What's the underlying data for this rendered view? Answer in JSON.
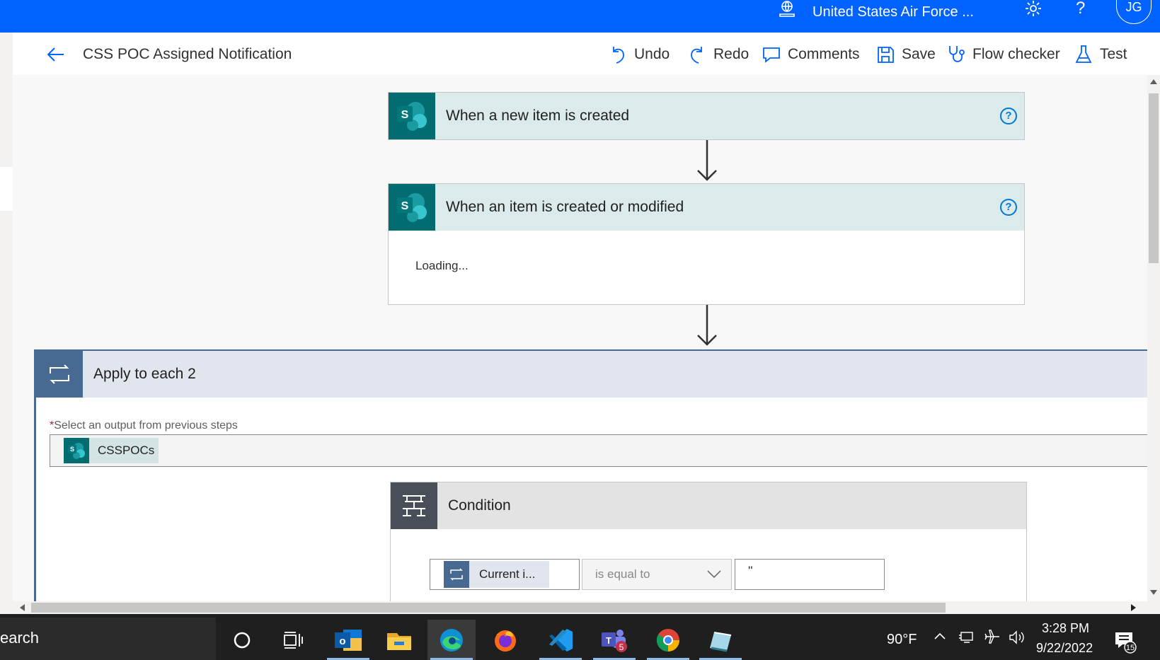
{
  "header": {
    "environment": "United States Air Force ...",
    "avatar_initials": "JG",
    "help_label": "?"
  },
  "commandbar": {
    "flow_title": "CSS POC Assigned Notification",
    "undo": "Undo",
    "redo": "Redo",
    "comments": "Comments",
    "save": "Save",
    "flow_checker": "Flow checker",
    "test": "Test"
  },
  "canvas": {
    "trigger": {
      "title": "When a new item is created",
      "icon_letter": "S"
    },
    "step2": {
      "title": "When an item is created or modified",
      "icon_letter": "S",
      "status": "Loading..."
    },
    "apply_each": {
      "title": "Apply to each 2",
      "required_mark": "*",
      "field_label": "Select an output from previous steps",
      "token": "CSSPOCs",
      "token_icon_letter": "S"
    },
    "condition": {
      "title": "Condition",
      "left_token": "Current i...",
      "operator": "is equal to",
      "right_value": "''"
    }
  },
  "taskbar": {
    "search_text": "earch",
    "teams_badge": "5",
    "temperature": "90°F",
    "time": "3:28 PM",
    "date": "9/22/2022",
    "notification_count": "15"
  },
  "colors": {
    "brand_blue": "#0063ff",
    "sharepoint_teal": "#036c70",
    "trigger_header": "#dbeaeb",
    "loop_header": "#e1e6ee",
    "loop_icon": "#486991",
    "condition_icon": "#484f58"
  }
}
